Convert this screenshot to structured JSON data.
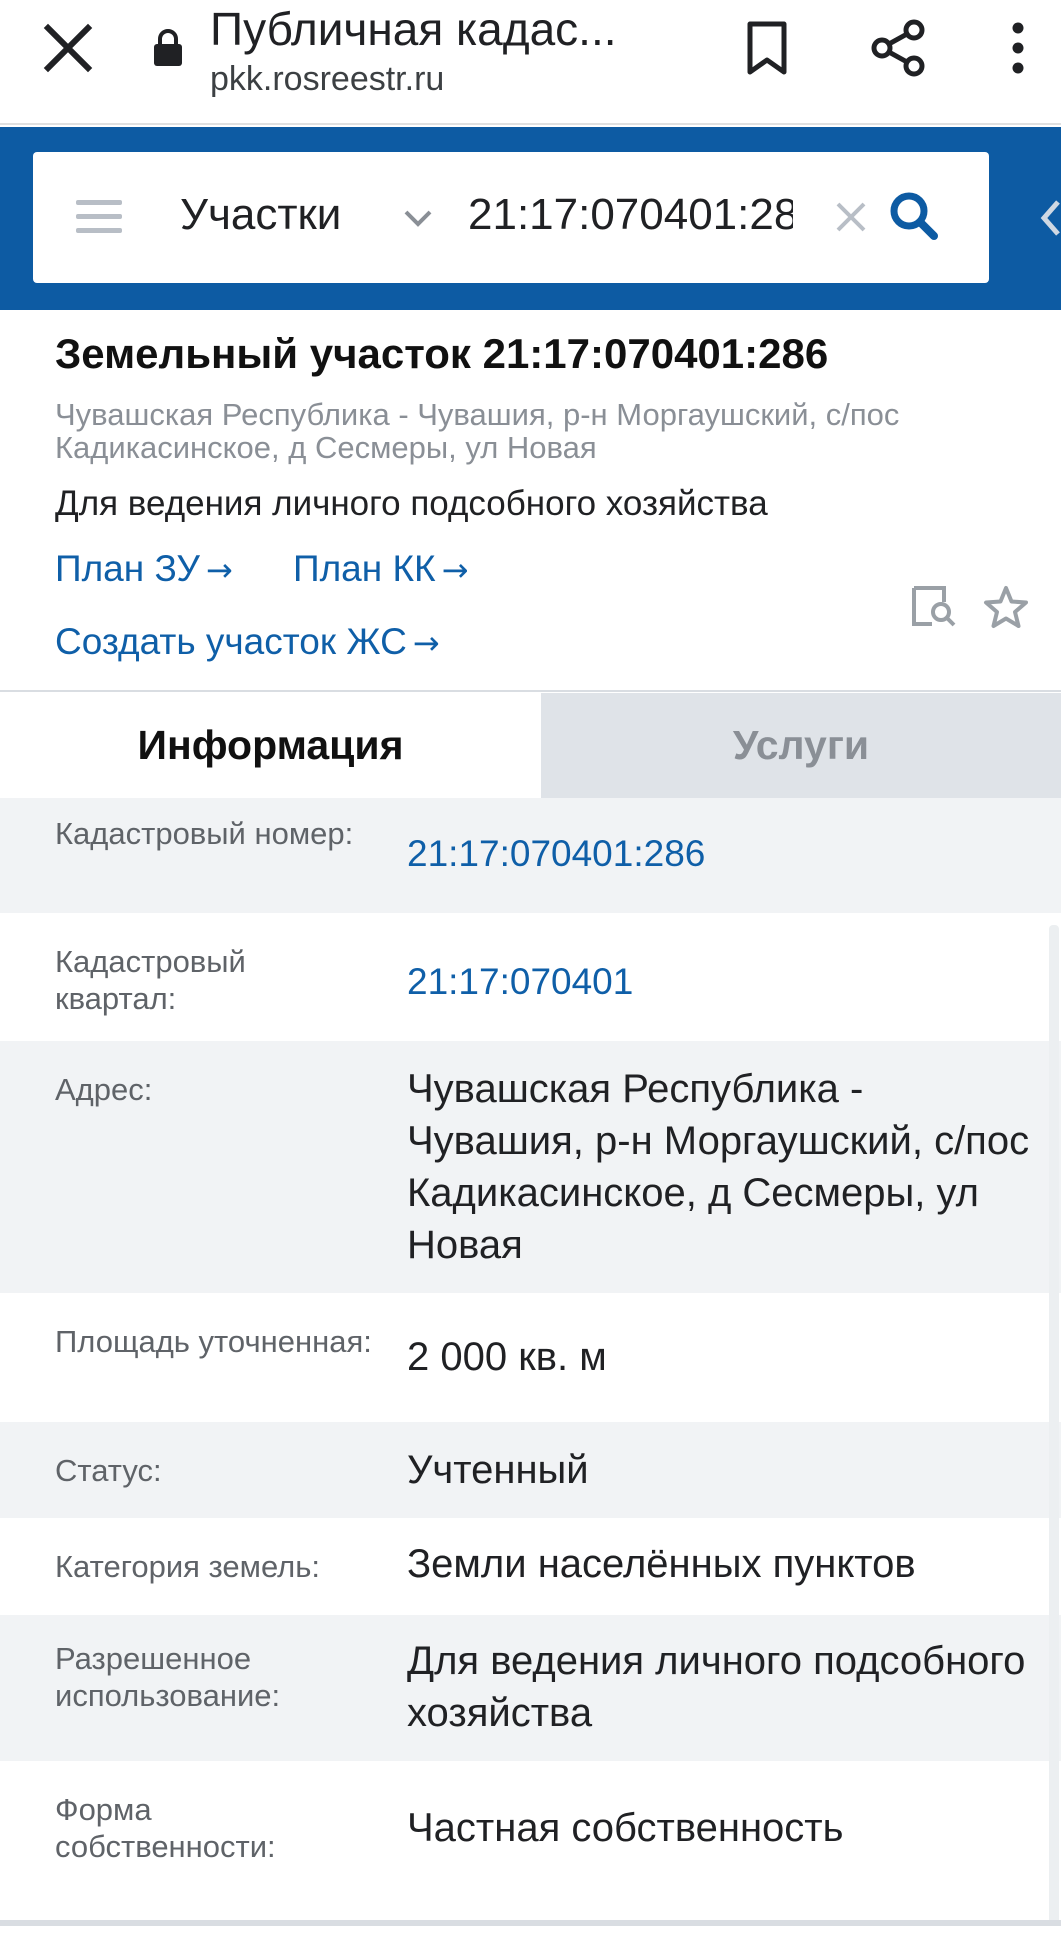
{
  "browser": {
    "page_title": "Публичная кадас...",
    "url": "pkk.rosreestr.ru"
  },
  "search": {
    "category": "Участки",
    "query": "21:17:070401:28"
  },
  "plot": {
    "title": "Земельный участок 21:17:070401:286",
    "address": "Чувашская Республика - Чувашия, р-н Моргаушский, с/пос Кадикасинское, д Сесмеры, ул Новая",
    "use": "Для ведения личного подсобного хозяйства",
    "links": {
      "plan_zu": "План ЗУ",
      "plan_kk": "План КК",
      "create_js": "Создать участок ЖС"
    }
  },
  "tabs": {
    "info": "Информация",
    "services": "Услуги"
  },
  "info_rows": [
    {
      "label": "Кадастровый номер:",
      "value": "21:17:070401:286"
    },
    {
      "label": "Кадастровый квартал:",
      "value": "21:17:070401"
    },
    {
      "label": "Адрес:",
      "value": "Чувашская Республика - Чувашия, р-н Моргаушский, с/пос Кадикасинское, д Сесмеры, ул Новая"
    },
    {
      "label": "Площадь уточненная:",
      "value": "2 000 кв. м"
    },
    {
      "label": "Статус:",
      "value": "Учтенный"
    },
    {
      "label": "Категория земель:",
      "value": "Земли населённых пунктов"
    },
    {
      "label": "Разрешенное использование:",
      "value": "Для ведения личного подсобного хозяйства"
    },
    {
      "label": "Форма собственности:",
      "value": "Частная собственность"
    }
  ],
  "colors": {
    "brand_blue": "#0d5ba3",
    "link_blue": "#0f5fa8",
    "row_shade": "#f1f3f5",
    "tab_inactive": "#dfe3e8"
  }
}
